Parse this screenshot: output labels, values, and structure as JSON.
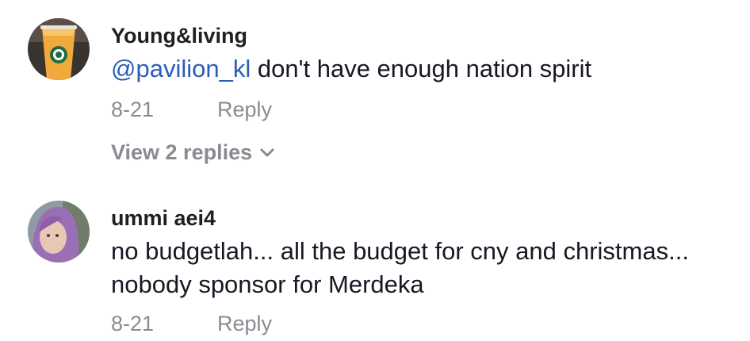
{
  "comments": [
    {
      "username": "Young&living",
      "mention": "@pavilion_kl",
      "text": " don't have enough nation spirit",
      "date": "8-21",
      "reply_label": "Reply",
      "view_replies_label": "View 2 replies",
      "avatar_icon": "drink-cup-avatar"
    },
    {
      "username": "ummi aei4",
      "text_lines": [
        "no budgetlah... all the budget for cny and christmas...",
        "nobody sponsor for Merdeka"
      ],
      "date": "8-21",
      "reply_label": "Reply",
      "avatar_icon": "person-avatar"
    }
  ],
  "colors": {
    "mention": "#2b5db9",
    "meta": "#8a8b91",
    "text": "#161823"
  }
}
